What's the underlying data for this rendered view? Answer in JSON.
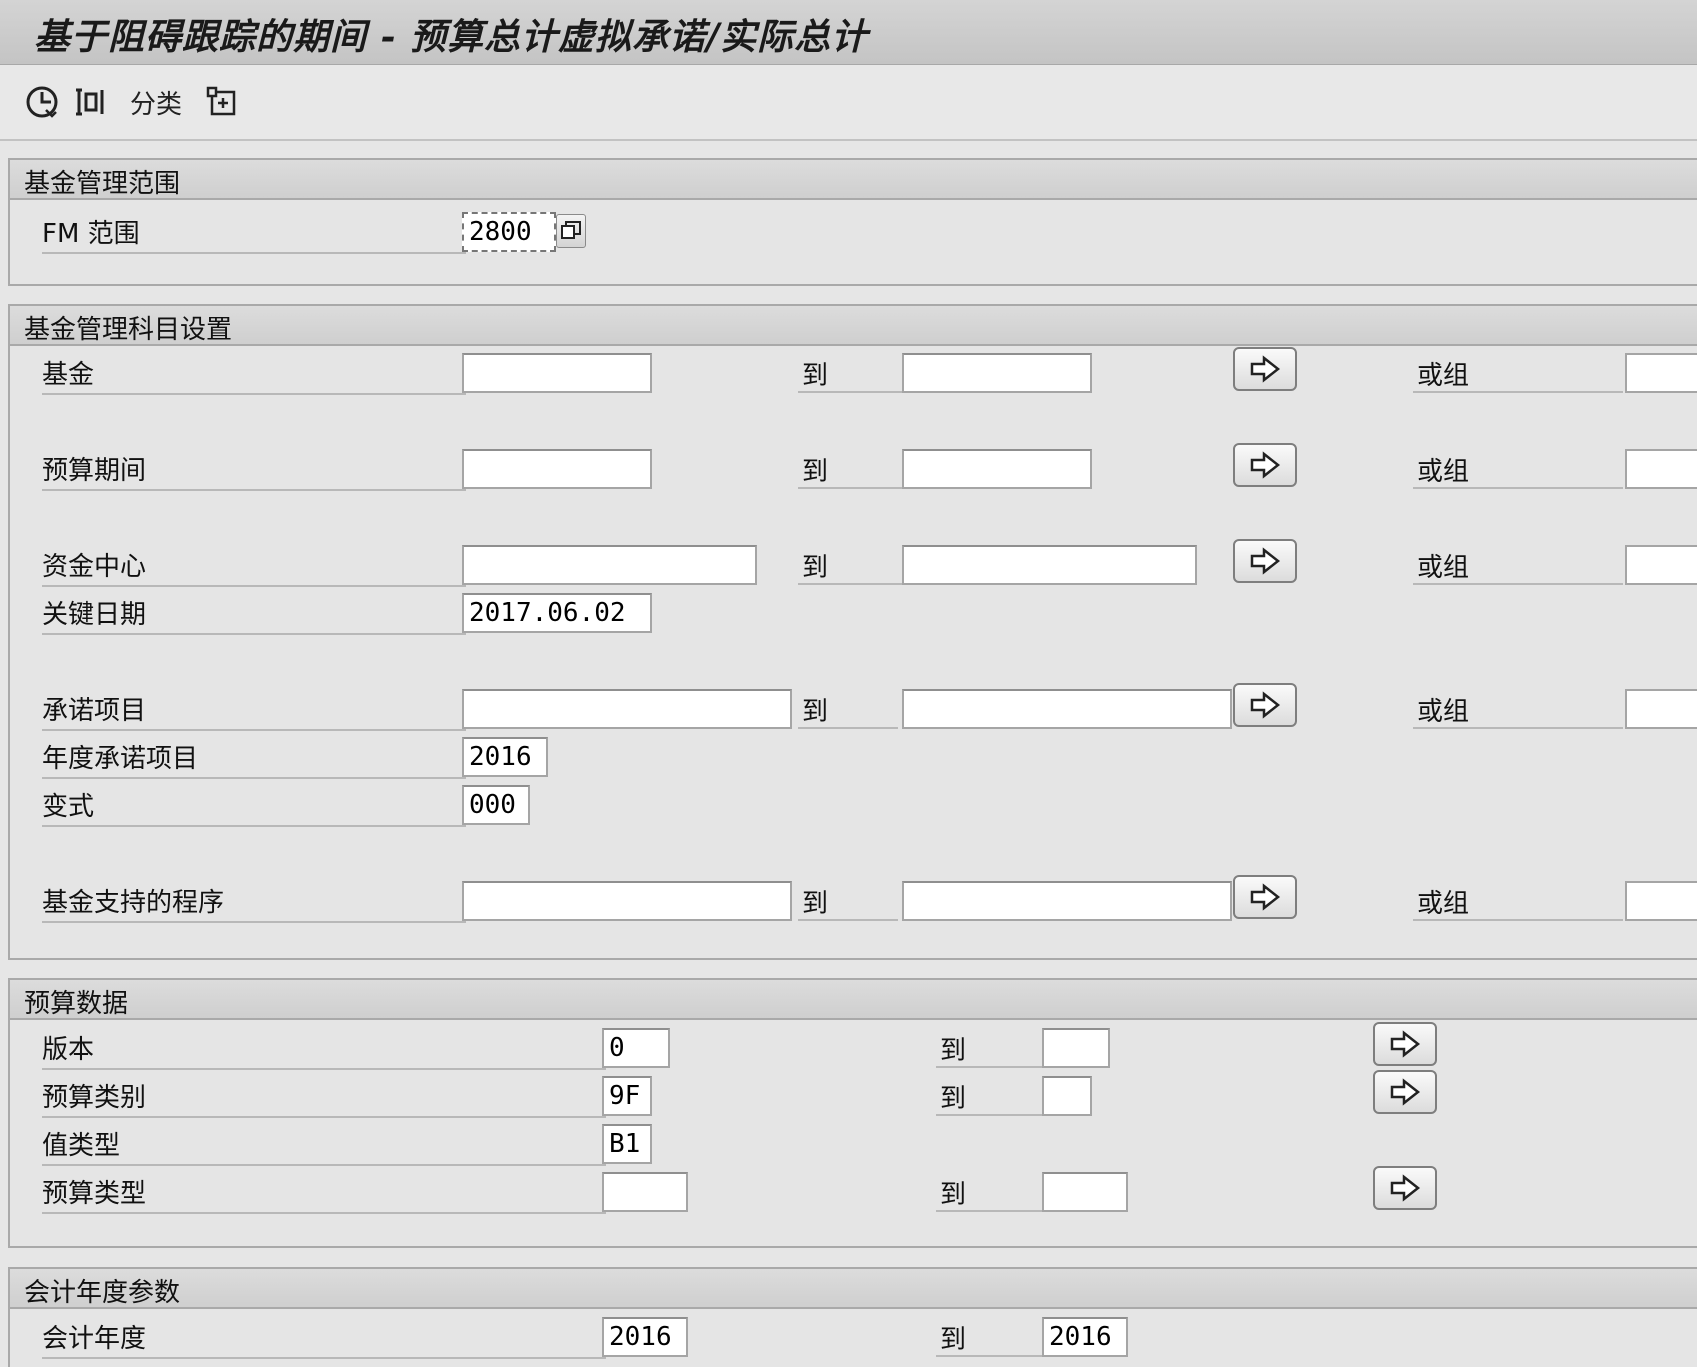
{
  "window": {
    "title": "基于阻碍跟踪的期间 - 预算总计虚拟承诺/实际总计"
  },
  "toolbar": {
    "sort_label": "分类"
  },
  "fm_area_section": {
    "title": "基金管理范围",
    "label": "FM 范围",
    "value": "2800"
  },
  "account_section": {
    "title": "基金管理科目设置",
    "to_label": "到",
    "or_group_label": "或组",
    "rows": [
      {
        "label": "基金",
        "from": "",
        "to": ""
      },
      {
        "label": "预算期间",
        "from": "",
        "to": ""
      },
      {
        "label": "资金中心",
        "from": "",
        "to": ""
      },
      {
        "label": "关键日期",
        "value": "2017.06.02"
      },
      {
        "label": "承诺项目",
        "from": "",
        "to": ""
      },
      {
        "label": "年度承诺项目",
        "value": "2016"
      },
      {
        "label": "变式",
        "value": "000"
      },
      {
        "label": "基金支持的程序",
        "from": "",
        "to": ""
      }
    ]
  },
  "budget_section": {
    "title": "预算数据",
    "to_label": "到",
    "rows": [
      {
        "label": "版本",
        "from": "0",
        "to": ""
      },
      {
        "label": "预算类别",
        "from": "9F",
        "to": ""
      },
      {
        "label": "值类型",
        "value": "B1"
      },
      {
        "label": "预算类型",
        "from": "",
        "to": ""
      }
    ]
  },
  "fiscal_section": {
    "title": "会计年度参数",
    "to_label": "到",
    "label": "会计年度",
    "from": "2016",
    "to": "2016"
  }
}
